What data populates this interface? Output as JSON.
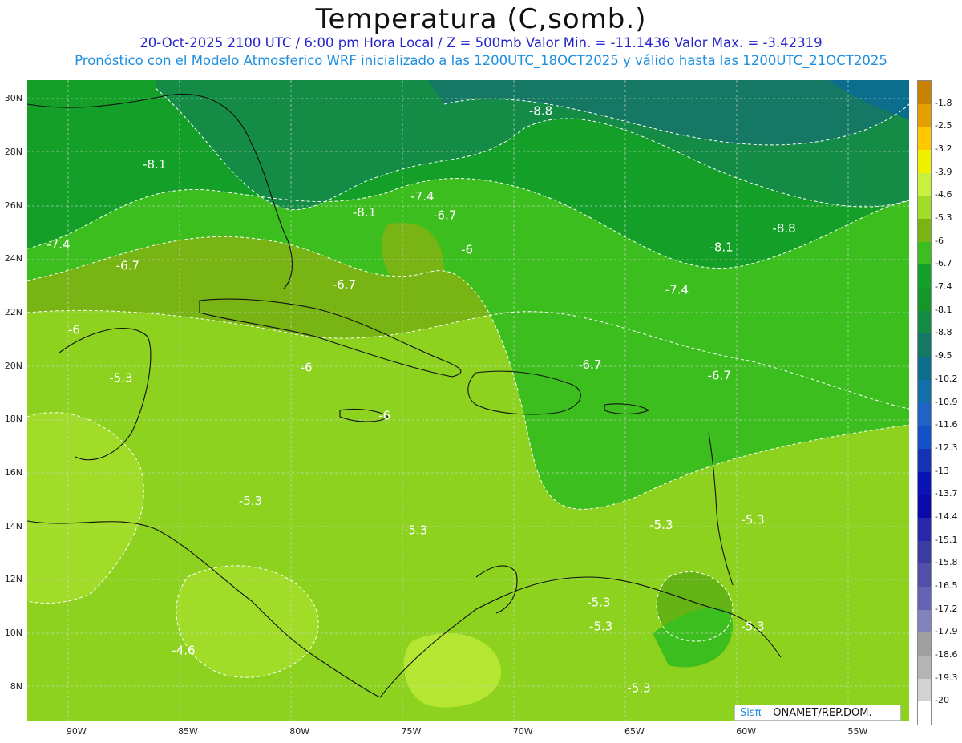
{
  "header": {
    "title": "Temperatura (C,somb.)",
    "line1": "20-Oct-2025  2100 UTC / 6:00 pm Hora Local / Z = 500mb  Valor Min. = -11.1436  Valor Max. = -3.42319",
    "line2": "Pronóstico con el Modelo Atmosferico WRF inicializado a las 1200UTC_18OCT2025 y válido hasta las  1200UTC_21OCT2025"
  },
  "map": {
    "lat_labels": [
      "30N",
      "28N",
      "26N",
      "24N",
      "22N",
      "20N",
      "18N",
      "16N",
      "14N",
      "12N",
      "10N",
      "8N"
    ],
    "lon_labels": [
      "90W",
      "85W",
      "80W",
      "75W",
      "70W",
      "65W",
      "60W",
      "55W"
    ],
    "contour_labels": [
      {
        "text": "-8.8",
        "lon": -69.2,
        "lat": 29.4
      },
      {
        "text": "-8.1",
        "lon": -86.5,
        "lat": 27.4
      },
      {
        "text": "-8.1",
        "lon": -77.1,
        "lat": 25.6
      },
      {
        "text": "-7.4",
        "lon": -74.5,
        "lat": 26.2
      },
      {
        "text": "-6.7",
        "lon": -73.5,
        "lat": 25.5
      },
      {
        "text": "-8.8",
        "lon": -58.3,
        "lat": 25.0
      },
      {
        "text": "-7.4",
        "lon": -90.8,
        "lat": 24.4
      },
      {
        "text": "-8.1",
        "lon": -61.1,
        "lat": 24.3
      },
      {
        "text": "-6",
        "lon": -72.5,
        "lat": 24.2
      },
      {
        "text": "-6.7",
        "lon": -87.7,
        "lat": 23.6
      },
      {
        "text": "-6.7",
        "lon": -78.0,
        "lat": 22.9
      },
      {
        "text": "-7.4",
        "lon": -63.1,
        "lat": 22.7
      },
      {
        "text": "-6",
        "lon": -90.1,
        "lat": 21.2
      },
      {
        "text": "-6.7",
        "lon": -67.0,
        "lat": 19.9
      },
      {
        "text": "-6",
        "lon": -79.7,
        "lat": 19.8
      },
      {
        "text": "-6.7",
        "lon": -61.2,
        "lat": 19.5
      },
      {
        "text": "-5.3",
        "lon": -88.0,
        "lat": 19.4
      },
      {
        "text": "-6",
        "lon": -76.2,
        "lat": 18.0
      },
      {
        "text": "-5.3",
        "lon": -82.2,
        "lat": 14.8
      },
      {
        "text": "-5.3",
        "lon": -63.8,
        "lat": 13.9
      },
      {
        "text": "-5.3",
        "lon": -59.7,
        "lat": 14.1
      },
      {
        "text": "-5.3",
        "lon": -74.8,
        "lat": 13.7
      },
      {
        "text": "-5.3",
        "lon": -66.6,
        "lat": 11.0
      },
      {
        "text": "-5.3",
        "lon": -66.5,
        "lat": 10.1
      },
      {
        "text": "-5.3",
        "lon": -59.7,
        "lat": 10.1
      },
      {
        "text": "-4.6",
        "lon": -85.2,
        "lat": 9.2
      },
      {
        "text": "-5.3",
        "lon": -64.8,
        "lat": 7.8
      }
    ],
    "credit_sis": "Sisπ",
    "credit_rest": " – ONAMET/REP.DOM."
  },
  "colorbar": {
    "labels": [
      "-1.8",
      "-2.5",
      "-3.2",
      "-3.9",
      "-4.6",
      "-5.3",
      "-6",
      "-6.7",
      "-7.4",
      "-8.1",
      "-8.8",
      "-9.5",
      "-10.2",
      "-10.9",
      "-11.6",
      "-12.3",
      "-13",
      "-13.7",
      "-14.4",
      "-15.1",
      "-15.8",
      "-16.5",
      "-17.2",
      "-17.9",
      "-18.6",
      "-19.3",
      "-20"
    ],
    "colors": [
      "#c88200",
      "#e3a000",
      "#ffc800",
      "#f0f000",
      "#c8f03c",
      "#a0dc28",
      "#78b414",
      "#3cbe1e",
      "#14a028",
      "#149628",
      "#148c46",
      "#147864",
      "#0a6e8c",
      "#146eaa",
      "#1e64c8",
      "#1450c8",
      "#1432b4",
      "#0a14b4",
      "#0a0aaa",
      "#2828aa",
      "#3c3ca0",
      "#5050aa",
      "#6464b4",
      "#8282be",
      "#a0a0a0",
      "#b4b4b4",
      "#d2d2d2",
      "#ffffff"
    ]
  }
}
